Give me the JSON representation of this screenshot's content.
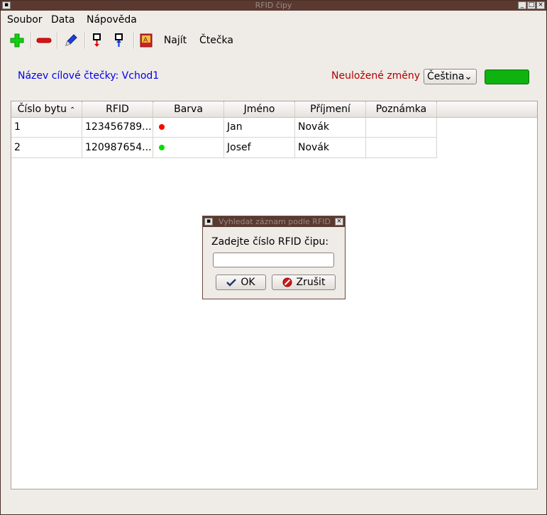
{
  "window": {
    "title": "RFID čipy"
  },
  "menu": {
    "items": [
      "Soubor",
      "Data",
      "Nápověda"
    ]
  },
  "toolbar": {
    "find_label": "Najít",
    "reader_label": "Čtečka"
  },
  "status": {
    "target_reader": "Název cílové čtečky: Vchod1",
    "unsaved_changes": "Neuložené změny",
    "language": "Čeština",
    "indicator_color": "#0fb30f"
  },
  "table": {
    "columns": [
      "Číslo bytu",
      "RFID",
      "Barva",
      "Jméno",
      "Příjmení",
      "Poznámka"
    ],
    "rows": [
      {
        "apt": "1",
        "rfid": "123456789...",
        "color": "#ff0000",
        "first": "Jan",
        "last": "Novák",
        "note": ""
      },
      {
        "apt": "2",
        "rfid": "120987654...",
        "color": "#00e000",
        "first": "Josef",
        "last": "Novák",
        "note": ""
      }
    ]
  },
  "dialog": {
    "title": "Vyhledat záznam podle RFID",
    "prompt": "Zadejte číslo RFID čipu:",
    "input_value": "",
    "ok_label": "OK",
    "cancel_label": "Zrušit"
  }
}
